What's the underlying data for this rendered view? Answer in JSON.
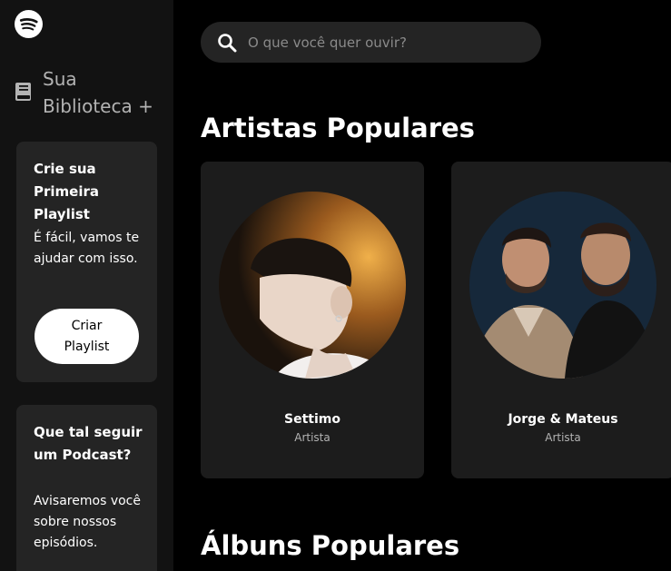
{
  "sidebar": {
    "library_label": "Sua Biblioteca +",
    "cards": [
      {
        "title": "Crie sua Primeira Playlist",
        "text": "É fácil, vamos te ajudar com isso.",
        "button_label": "Criar Playlist"
      },
      {
        "title": "Que tal seguir um Podcast?",
        "text": "Avisaremos você sobre nossos episódios."
      }
    ]
  },
  "search": {
    "placeholder": "O que você quer ouvir?"
  },
  "sections": {
    "artists_title": "Artistas Populares",
    "albums_title": "Álbuns Populares"
  },
  "artists": [
    {
      "name": "Settimo",
      "type": "Artista"
    },
    {
      "name": "Jorge & Mateus",
      "type": "Artista"
    }
  ],
  "colors": {
    "background": "#000000",
    "sidebar": "#121212",
    "card": "#242424",
    "artist_card": "#1c1c1c"
  }
}
